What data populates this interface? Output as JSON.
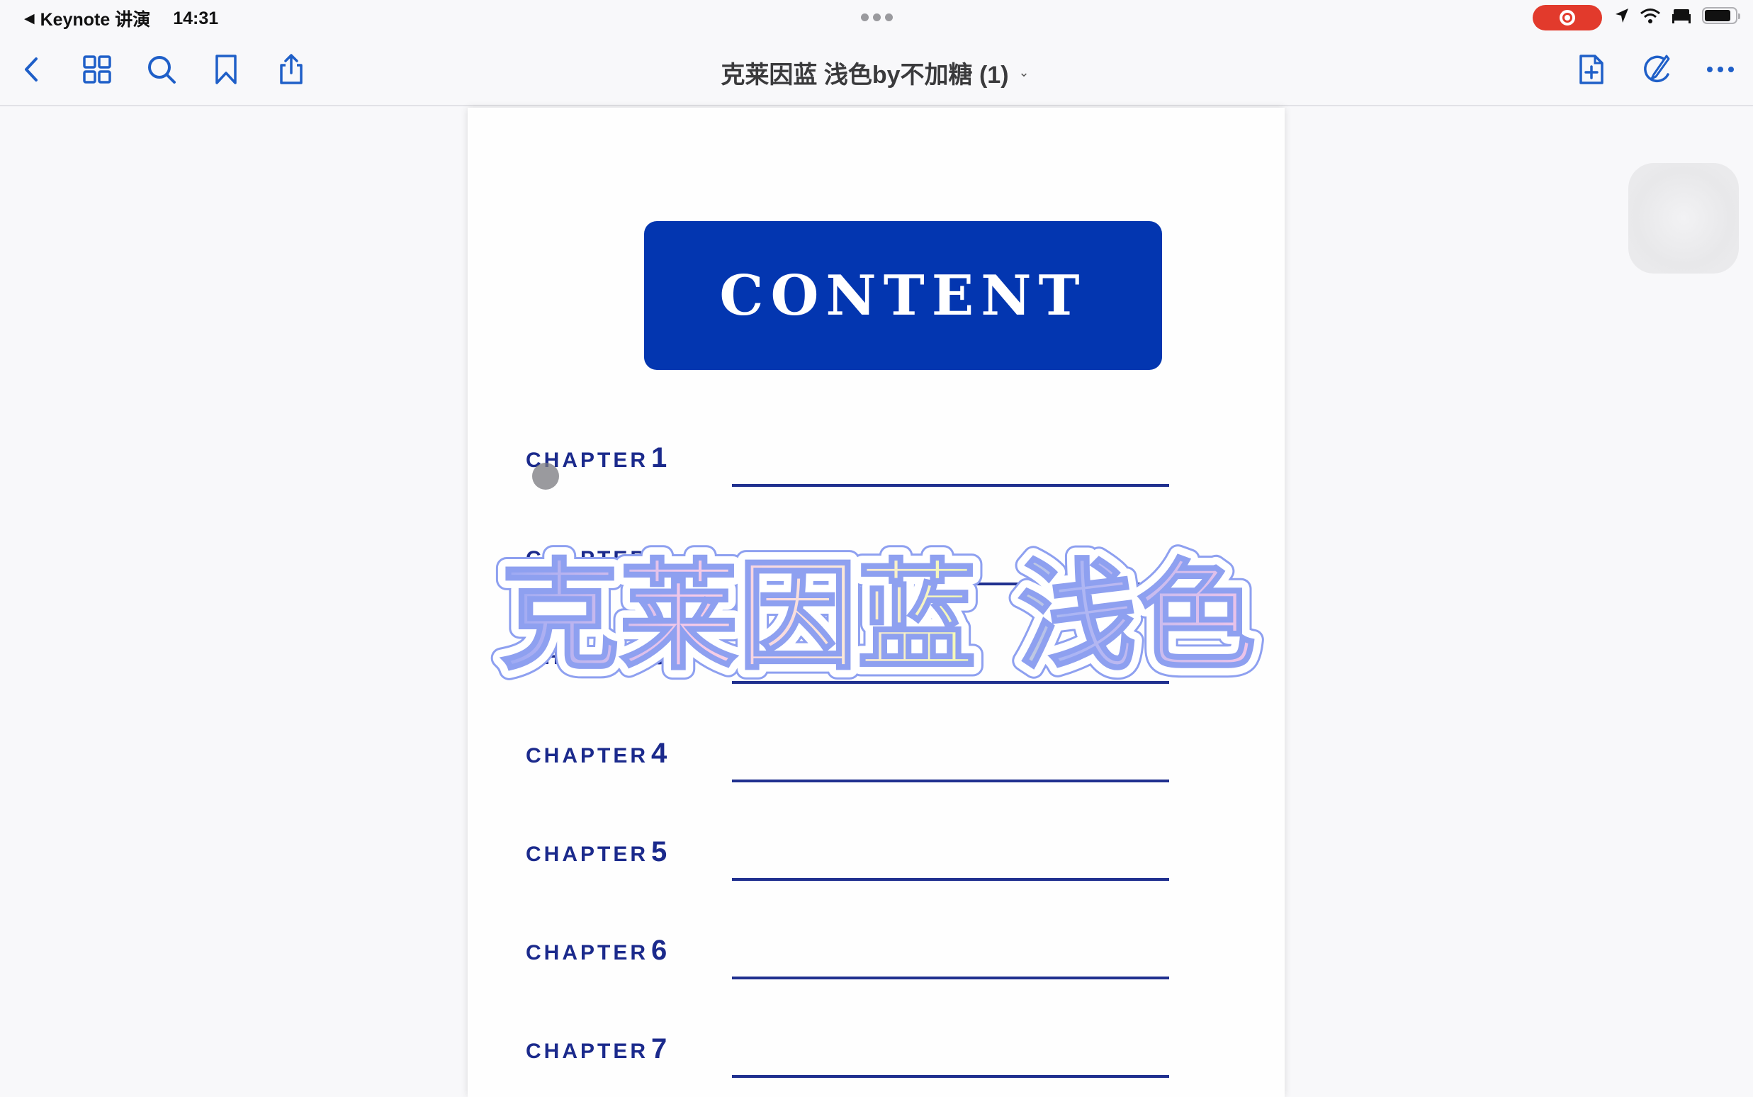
{
  "status_bar": {
    "back_app": "Keynote 讲演",
    "time": "14:31",
    "recording": true,
    "battery_level": 0.9
  },
  "nav": {
    "title": "克莱因蓝 浅色by不加糖 (1)",
    "left_icons": [
      "back-icon",
      "grid-icon",
      "search-icon",
      "bookmark-icon",
      "share-icon"
    ],
    "right_icons": [
      "add-page-icon",
      "markup-icon",
      "more-icon"
    ],
    "accent_color": "#1f5fc8"
  },
  "page": {
    "heading": "CONTENT",
    "heading_bg": "#0336b0",
    "chapters": [
      {
        "label": "CHAPTER",
        "num": "1"
      },
      {
        "label": "CHAPTER",
        "num": "2"
      },
      {
        "label": "CHAPTER",
        "num": "3"
      },
      {
        "label": "CHAPTER",
        "num": "4"
      },
      {
        "label": "CHAPTER",
        "num": "5"
      },
      {
        "label": "CHAPTER",
        "num": "6"
      },
      {
        "label": "CHAPTER",
        "num": "7"
      }
    ],
    "text_color": "#1b2a8c"
  },
  "overlay": {
    "text": "克莱因蓝 浅色"
  }
}
